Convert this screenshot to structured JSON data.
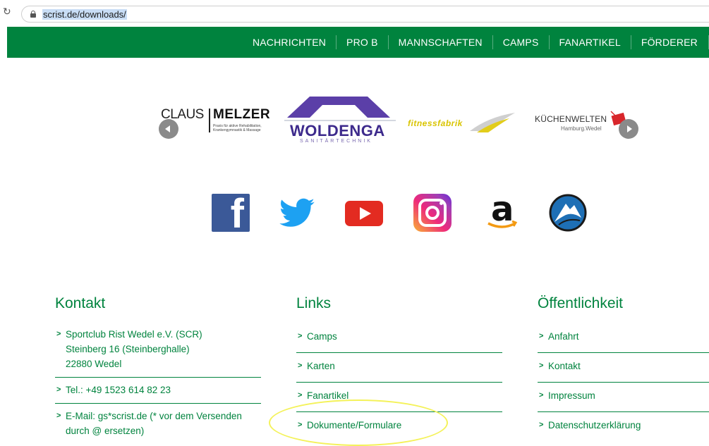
{
  "browser": {
    "url": "scrist.de/downloads/",
    "reload_icon": "reload-icon",
    "lock_icon": "lock-icon"
  },
  "nav": {
    "items": [
      "NACHRICHTEN",
      "PRO B",
      "MANNSCHAFTEN",
      "CAMPS",
      "FANARTIKEL",
      "FÖRDERER"
    ],
    "background": "#00833e"
  },
  "sponsors": {
    "melzer": {
      "left": "CLAUS",
      "right": "MELZER",
      "sub": "Praxis für aktive Rehabilitation, Krankengymnastik & Massage"
    },
    "woldenga": {
      "name": "WOLDENGA",
      "sub": "SANITÄRTECHNIK"
    },
    "fitness": {
      "name": "fitnessfabrik"
    },
    "kuechen": {
      "name": "KÜCHENWELTEN",
      "sub": "Hamburg.Wedel"
    }
  },
  "social": [
    "facebook-icon",
    "twitter-icon",
    "youtube-icon",
    "instagram-icon",
    "amazon-icon",
    "mountain-icon"
  ],
  "footer": {
    "kontakt": {
      "title": "Kontakt",
      "address": [
        "Sportclub Rist Wedel e.V. (SCR)",
        "Steinberg 16 (Steinberghalle)",
        "22880 Wedel"
      ],
      "tel": "Tel.: +49 1523 614 82 23",
      "email": "E-Mail: gs*scrist.de (* vor dem Versenden durch @ ersetzen)"
    },
    "links": {
      "title": "Links",
      "items": [
        "Camps",
        "Karten",
        "Fanartikel",
        "Dokumente/Formulare"
      ]
    },
    "oeffentlichkeit": {
      "title": "Öffentlichkeit",
      "items": [
        "Anfahrt",
        "Kontakt",
        "Impressum",
        "Datenschutzerklärung"
      ]
    }
  },
  "colors": {
    "green": "#00833e",
    "highlight": "#f4f25a"
  }
}
